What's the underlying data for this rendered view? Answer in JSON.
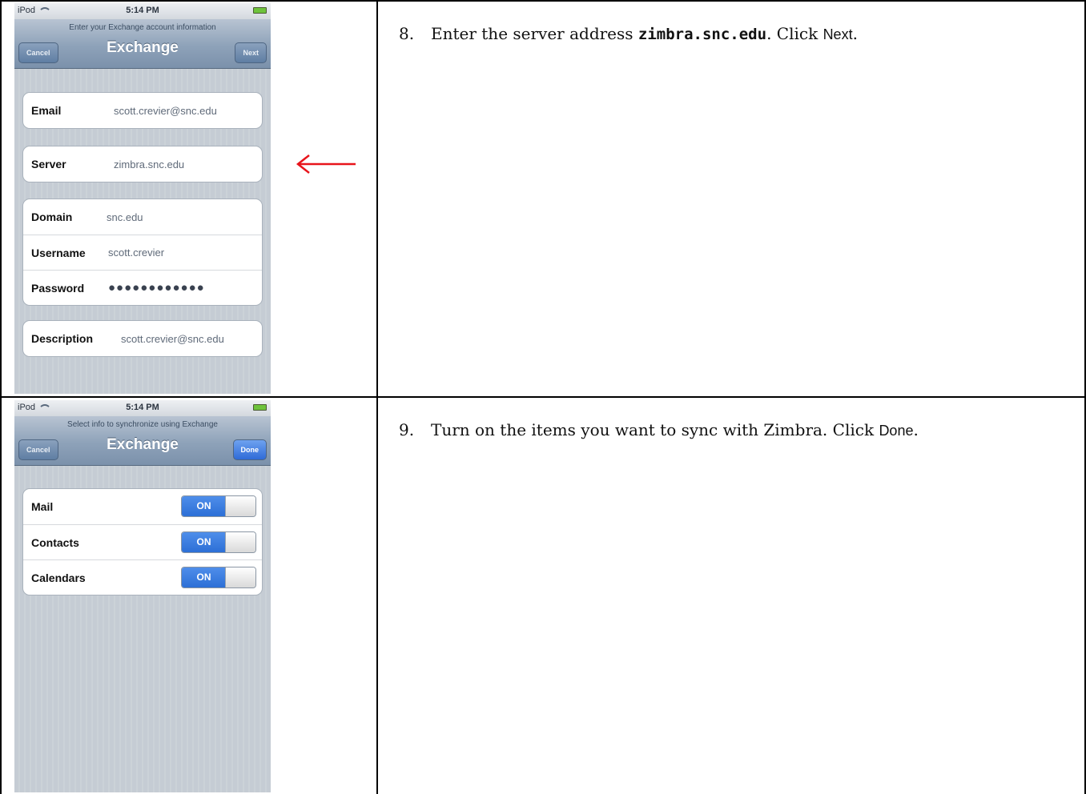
{
  "status_bar": {
    "device": "iPod",
    "time": "5:14 PM"
  },
  "screen1": {
    "prompt": "Enter your Exchange account information",
    "title": "Exchange",
    "left_button": "Cancel",
    "right_button": "Next",
    "email": {
      "label": "Email",
      "value": "scott.crevier@snc.edu"
    },
    "server": {
      "label": "Server",
      "value": "zimbra.snc.edu"
    },
    "domain": {
      "label": "Domain",
      "value": "snc.edu"
    },
    "username": {
      "label": "Username",
      "value": "scott.crevier"
    },
    "password": {
      "label": "Password",
      "value": "●●●●●●●●●●●●"
    },
    "description": {
      "label": "Description",
      "value": "scott.crevier@snc.edu"
    }
  },
  "screen2": {
    "prompt": "Select info to synchronize using Exchange",
    "title": "Exchange",
    "left_button": "Cancel",
    "right_button": "Done",
    "items": [
      {
        "label": "Mail",
        "state": "ON"
      },
      {
        "label": "Contacts",
        "state": "ON"
      },
      {
        "label": "Calendars",
        "state": "ON"
      }
    ]
  },
  "steps": {
    "step8": {
      "num": "8.",
      "text_before": "Enter the server address ",
      "code": "zimbra.snc.edu",
      "text_mid": ". Click ",
      "ui": "Next",
      "text_end": "."
    },
    "step9": {
      "num": "9.",
      "text_before": "Turn on the items you want to sync with Zimbra. Click ",
      "ui": "Done",
      "text_end": "."
    }
  },
  "colors": {
    "arrow": "#e8141b",
    "toggle_on": "#2c6fd6",
    "navbar": "#8ea2b9"
  }
}
